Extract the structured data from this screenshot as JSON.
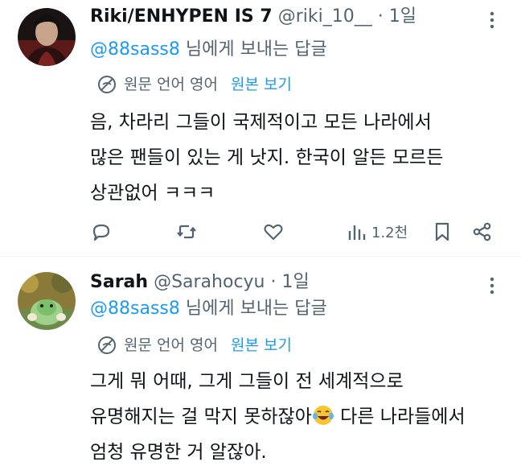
{
  "tweets": [
    {
      "name": "Riki/ENHYPEN IS 7",
      "handle": "@riki_10__",
      "dot": "·",
      "time": "1일",
      "reply_mention": "@88sass8",
      "reply_suffix": " 님에게 보내는 답글",
      "source_language": "원문 언어 영어",
      "show_original": "원본 보기",
      "body_lines": [
        "음, 차라리 그들이 국제적이고 모든 나라에서",
        "많은 팬들이 있는 게 낫지. 한국이 알든 모르든",
        "상관없어 ㅋㅋㅋ"
      ],
      "views": "1.2천"
    },
    {
      "name": "Sarah",
      "handle": "@Sarahocyu",
      "dot": "·",
      "time": "1일",
      "reply_mention": "@88sass8",
      "reply_suffix": " 님에게 보내는 답글",
      "source_language": "원문 언어 영어",
      "show_original": "원본 보기",
      "body_lines": [
        "그게 뭐 어때, 그게 그들이 전 세계적으로",
        "유명해지는 걸 막지 못하잖아",
        " 다른 나라들에서",
        "엄청 유명한 거 알잖아."
      ]
    }
  ],
  "colors": {
    "link": "#1d9bf0",
    "secondary": "#536471",
    "text": "#0f1419",
    "divider": "#eff3f4"
  },
  "icons": {
    "more": "more-vertical-icon",
    "translate": "globe-translate-icon",
    "reply": "reply-icon",
    "retweet": "retweet-icon",
    "like": "heart-icon",
    "views": "views-icon",
    "bookmark": "bookmark-icon",
    "share": "share-icon",
    "emoji": "face-tears-of-joy-emoji"
  }
}
